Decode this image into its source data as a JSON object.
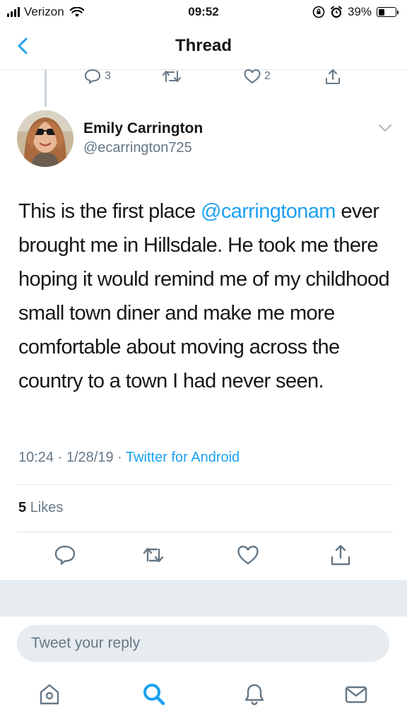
{
  "status_bar": {
    "carrier": "Verizon",
    "time": "09:52",
    "battery": "39%",
    "battery_level": 0.39
  },
  "nav": {
    "back_icon": "chevron-left-icon",
    "title": "Thread"
  },
  "previous_tweet": {
    "reply_count": "3",
    "like_count": "2"
  },
  "tweet": {
    "author_name": "Emily Carrington",
    "author_handle": "@ecarrington725",
    "text_before": "This is the first place ",
    "mention": "@carringtonam",
    "text_after": " ever brought me in Hillsdale. He took me there hoping it would remind me of my childhood small town diner and make me more comfortable about moving across the country to a town I had never seen.",
    "time": "10:24",
    "date": "1/28/19",
    "source": "Twitter for Android",
    "likes_count": "5",
    "likes_label": "Likes"
  },
  "reply": {
    "placeholder": "Tweet your reply"
  },
  "colors": {
    "accent": "#1da1f2",
    "secondary_text": "#657786",
    "divider": "#e1e8ed",
    "band": "#e6ecf0"
  }
}
